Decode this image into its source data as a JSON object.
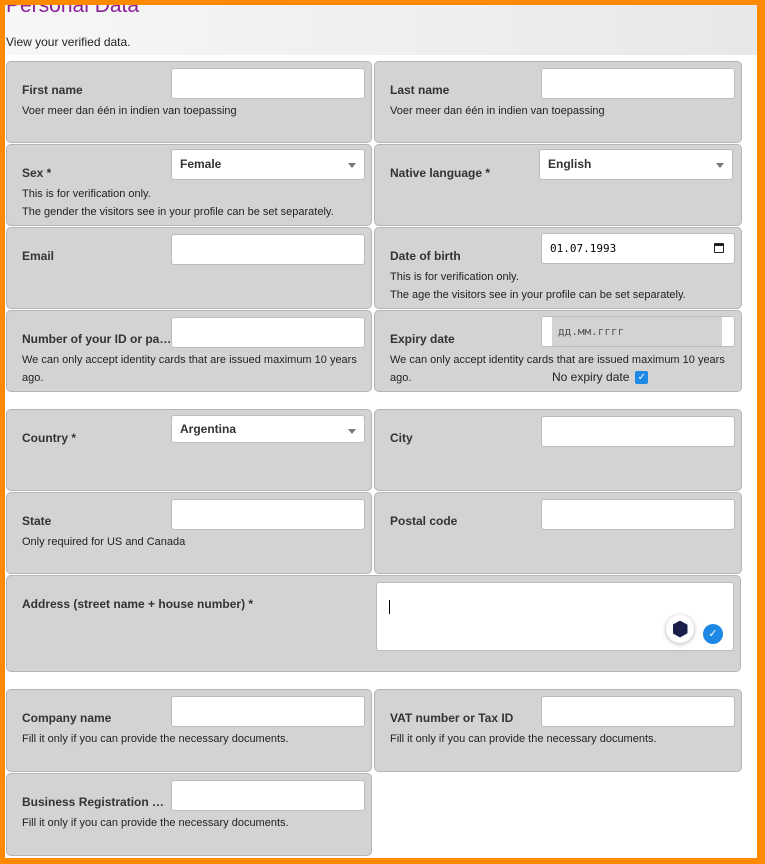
{
  "header": {
    "title": "Personal Data",
    "subtitle": "View your verified data."
  },
  "fields": {
    "first_name": {
      "label": "First name",
      "hint": "Voer meer dan één in indien van toepassing",
      "value": ""
    },
    "last_name": {
      "label": "Last name",
      "hint": "Voer meer dan één in indien van toepassing",
      "value": ""
    },
    "sex": {
      "label": "Sex *",
      "value": "Female",
      "hint1": "This is for verification only.",
      "hint2": "The gender the visitors see in your profile can be set separately."
    },
    "native_language": {
      "label": "Native language *",
      "value": "English"
    },
    "email": {
      "label": "Email",
      "value": ""
    },
    "dob": {
      "label": "Date of birth",
      "value": "01.07.1993",
      "hint1": "This is for verification only.",
      "hint2": "The age the visitors see in your profile can be set separately."
    },
    "id_number": {
      "label": "Number of your ID or passport",
      "hint": "We can only accept identity cards that are issued maximum 10 years ago.",
      "value": ""
    },
    "expiry": {
      "label": "Expiry date",
      "placeholder": "дд.мм.гггг",
      "hint": "We can only accept identity cards that are issued maximum 10 years ago.",
      "no_expiry_label": "No expiry date",
      "no_expiry_checked": true
    },
    "country": {
      "label": "Country *",
      "value": "Argentina"
    },
    "city": {
      "label": "City",
      "value": ""
    },
    "state": {
      "label": "State",
      "hint": "Only required for US and Canada",
      "value": ""
    },
    "postal": {
      "label": "Postal code",
      "value": ""
    },
    "address": {
      "label": "Address (street name + house number) *",
      "value": ""
    },
    "company": {
      "label": "Company name",
      "hint": "Fill it only if you can provide the necessary documents.",
      "value": ""
    },
    "vat": {
      "label": "VAT number or Tax ID",
      "hint": "Fill it only if you can provide the necessary documents.",
      "value": ""
    },
    "business_reg": {
      "label": "Business Registration Number",
      "hint": "Fill it only if you can provide the necessary documents.",
      "value": ""
    }
  },
  "colors": {
    "accent": "#ff8a00",
    "title": "#8a1f9a",
    "check": "#1e88e5"
  }
}
